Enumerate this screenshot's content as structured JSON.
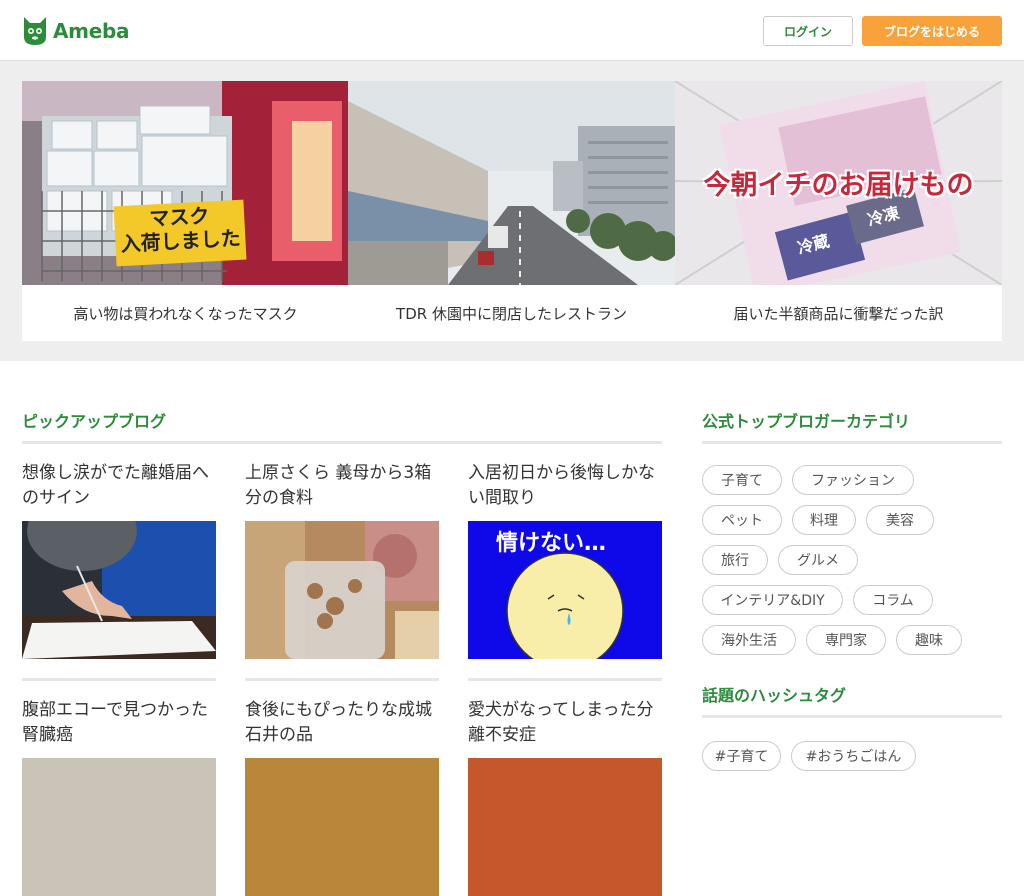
{
  "header": {
    "logo_text": "Ameba",
    "login_label": "ログイン",
    "start_label": "ブログをはじめる"
  },
  "hero": {
    "cards": [
      {
        "caption": "高い物は買われなくなったマスク",
        "sign_line1": "マスク",
        "sign_line2": "入荷しました"
      },
      {
        "caption": "TDR 休園中に閉店したレストラン"
      },
      {
        "caption": "届いた半額商品に衝撃だった訳",
        "overlay": "今朝イチのお届けもの",
        "tag1": "冷蔵",
        "tag2": "冷凍"
      }
    ]
  },
  "pickup": {
    "title": "ピックアップブログ",
    "blogs": [
      {
        "title": "想像し涙がでた離婚届へのサイン"
      },
      {
        "title": "上原さくら 義母から3箱分の食料"
      },
      {
        "title": "入居初日から後悔しかない間取り",
        "img_text": "情けない…"
      },
      {
        "title": "腹部エコーで見つかった腎臓癌"
      },
      {
        "title": "食後にもぴったりな成城石井の品"
      },
      {
        "title": "愛犬がなってしまった分離不安症"
      }
    ]
  },
  "categories": {
    "title": "公式トップブロガーカテゴリ",
    "items": [
      "子育て",
      "ファッション",
      "ペット",
      "料理",
      "美容",
      "旅行",
      "グルメ",
      "インテリア&DIY",
      "コラム",
      "海外生活",
      "専門家",
      "趣味"
    ]
  },
  "hashtags": {
    "title": "話題のハッシュタグ",
    "items": [
      "#子育て",
      "#おうちごはん"
    ]
  },
  "colors": {
    "brand_green": "#2d8c3c",
    "accent_orange": "#f7a23b"
  }
}
